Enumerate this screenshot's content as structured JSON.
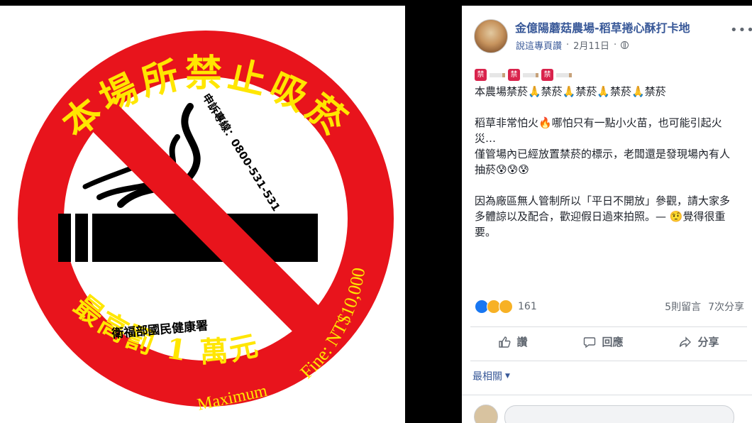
{
  "sign": {
    "top_text": "本場所禁止吸菸",
    "hotline": "申訴專線：0800-531-531",
    "agency": "衛福部國民健康署",
    "fine_zh": "最高罰 1 萬元",
    "maximum": "Maximum",
    "fine_en": "Fine: NT$10,000",
    "colors": {
      "ring": "#e8141c",
      "text": "#ffe600",
      "cigarette": "#000000"
    }
  },
  "post": {
    "page_name": "金億陽蘑菇農場-稻草捲心酥打卡地",
    "meta_link": "說這專頁讚",
    "separator": "·",
    "date": "2月11日",
    "paragraphs": [
      "本農場禁菸🙏禁菸🙏禁菸🙏禁菸🙏禁菸",
      "稻草非常怕火🔥哪怕只有一點小火苗，也可能引起火災…\n僅管場內已經放置禁菸的標示，老闆還是發現場內有人抽菸😰😰😰",
      "因為廠區無人管制所以「平日不開放」參觀，請大家多多體諒以及配合，歡迎假日過來拍照。— 🤨覺得很重要。"
    ],
    "reactions_count": "161",
    "comments_count": "5則留言",
    "shares_count": "7次分享",
    "actions": {
      "like": "讚",
      "comment": "回應",
      "share": "分享"
    },
    "sort_label": "最相關",
    "icons": [
      "thumbs-up-icon",
      "comment-icon",
      "share-icon",
      "globe-icon",
      "more-icon"
    ]
  }
}
